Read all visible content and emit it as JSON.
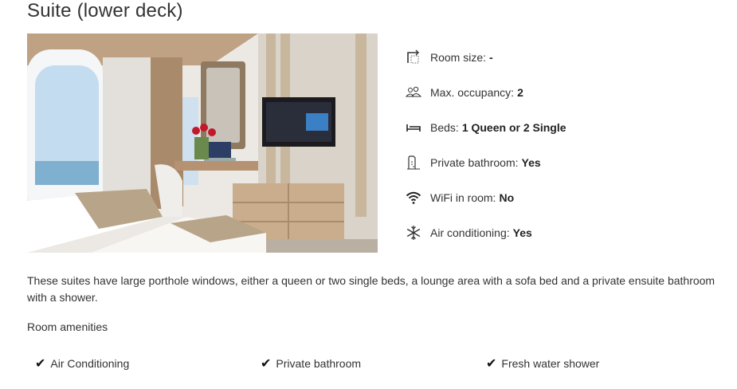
{
  "room": {
    "title": "Suite (lower deck)"
  },
  "specs": [
    {
      "icon": "room-size-icon",
      "label": "Room size:",
      "value": "-"
    },
    {
      "icon": "occupancy-icon",
      "label": "Max. occupancy:",
      "value": "2"
    },
    {
      "icon": "bed-icon",
      "label": "Beds:",
      "value": "1 Queen or 2 Single"
    },
    {
      "icon": "bathroom-icon",
      "label": "Private bathroom:",
      "value": "Yes"
    },
    {
      "icon": "wifi-icon",
      "label": "WiFi in room:",
      "value": "No"
    },
    {
      "icon": "snowflake-icon",
      "label": "Air conditioning:",
      "value": "Yes"
    }
  ],
  "description": "These suites have large porthole windows, either a queen or two single beds, a lounge area with a sofa bed and a private ensuite bathroom with a shower.",
  "amenities": {
    "title": "Room amenities",
    "items": [
      "Air Conditioning",
      "Private bathroom",
      "Fresh water shower"
    ]
  }
}
